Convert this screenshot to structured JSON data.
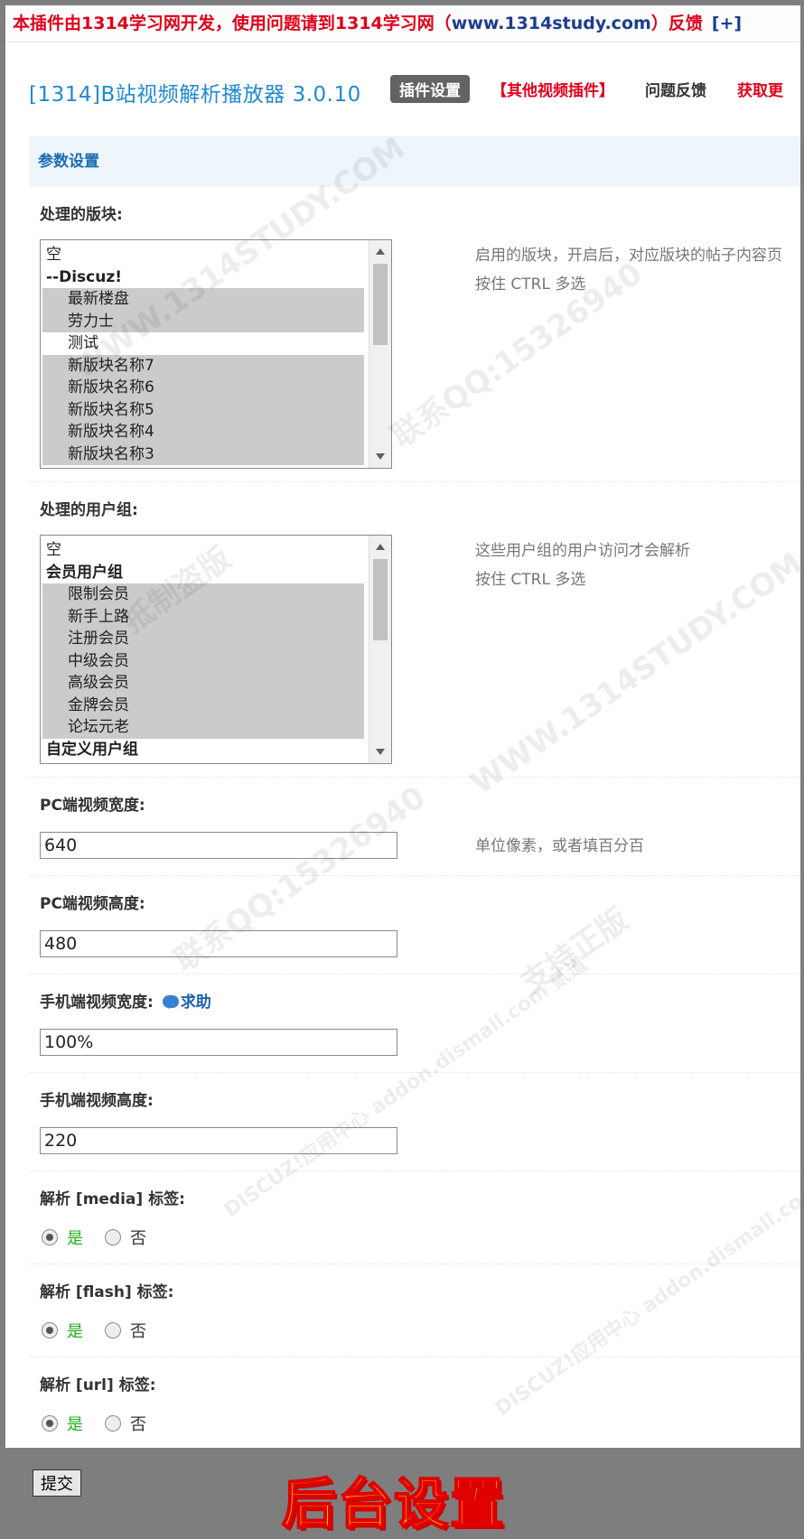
{
  "notice": {
    "text_before": "本插件由1314学习网开发，使用问题请到1314学习网（",
    "url": "www.1314study.com",
    "text_after": "）反馈",
    "expand": "[+]"
  },
  "header": {
    "app_title": "[1314]B站视频解析播放器 3.0.10",
    "tabs": [
      "插件设置",
      "【其他视频插件】",
      "问题反馈",
      "获取更"
    ]
  },
  "section": {
    "title": "参数设置"
  },
  "fields": {
    "forums": {
      "label": "处理的版块:",
      "tip_line1": "启用的版块，开启后，对应版块的帖子内容页",
      "tip_line2": "按住 CTRL 多选",
      "options": [
        "空",
        "--Discuz!",
        "最新楼盘",
        "劳力士",
        "测试",
        "新版块名称7",
        "新版块名称6",
        "新版块名称5",
        "新版块名称4",
        "新版块名称3"
      ]
    },
    "groups": {
      "label": "处理的用户组:",
      "tip_line1": "这些用户组的用户访问才会解析",
      "tip_line2": "按住 CTRL 多选",
      "options": [
        "空",
        "会员用户组",
        "限制会员",
        "新手上路",
        "注册会员",
        "中级会员",
        "高级会员",
        "金牌会员",
        "论坛元老",
        "自定义用户组"
      ]
    },
    "pc_width": {
      "label": "PC端视频宽度:",
      "value": "640",
      "tip": "单位像素，或者填百分百"
    },
    "pc_height": {
      "label": "PC端视频高度:",
      "value": "480"
    },
    "mobile_width": {
      "label": "手机端视频宽度:",
      "help": "求助",
      "value": "100%"
    },
    "mobile_height": {
      "label": "手机端视频高度:",
      "value": "220"
    },
    "media": {
      "label": "解析 [media] 标签:",
      "yes": "是",
      "no": "否"
    },
    "flash": {
      "label": "解析 [flash] 标签:",
      "yes": "是",
      "no": "否"
    },
    "url": {
      "label": "解析 [url] 标签:",
      "yes": "是",
      "no": "否"
    }
  },
  "footer": {
    "submit": "提交",
    "caption": "后台设置"
  },
  "watermark": [
    "WWW.1314STUDY.COM",
    "联系QQ:15326940",
    "抵制盗版",
    "支持正版",
    "DISCUZ!应用中心 addon.dismall.com 贰道"
  ],
  "colors": {
    "notice_red": "#e0001a",
    "title_blue": "#1f8ad1",
    "yes_green": "#22b022",
    "caption_yellow": "#ffee00"
  }
}
